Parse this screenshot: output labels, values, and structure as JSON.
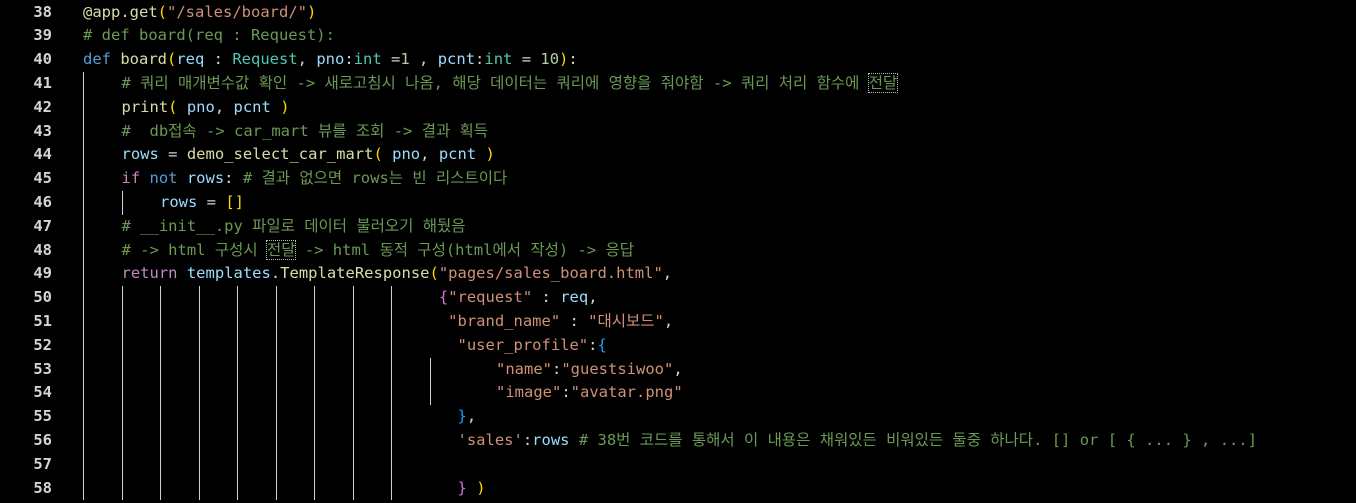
{
  "editor": {
    "lines": [
      {
        "n": "38",
        "ind": 0,
        "tokens": [
          [
            "fn",
            "@app.get"
          ],
          [
            "br1",
            "("
          ],
          [
            "str",
            "\"/sales/board/\""
          ],
          [
            "br1",
            ")"
          ]
        ]
      },
      {
        "n": "39",
        "ind": 0,
        "tokens": [
          [
            "cm",
            "# def board(req : Request):"
          ]
        ]
      },
      {
        "n": "40",
        "ind": 0,
        "tokens": [
          [
            "kw",
            "def "
          ],
          [
            "fn",
            "board"
          ],
          [
            "br1",
            "("
          ],
          [
            "var",
            "req"
          ],
          [
            "txt",
            " : "
          ],
          [
            "cls",
            "Request"
          ],
          [
            "txt",
            ", "
          ],
          [
            "var",
            "pno"
          ],
          [
            "txt",
            ":"
          ],
          [
            "cls",
            "int"
          ],
          [
            "txt",
            " ="
          ],
          [
            "num",
            "1"
          ],
          [
            "txt",
            " , "
          ],
          [
            "var",
            "pcnt"
          ],
          [
            "txt",
            ":"
          ],
          [
            "cls",
            "int"
          ],
          [
            "txt",
            " = "
          ],
          [
            "num",
            "10"
          ],
          [
            "br1",
            ")"
          ],
          [
            "txt",
            ":"
          ]
        ]
      },
      {
        "n": "41",
        "ind": 1,
        "tokens": [
          [
            "cm",
            "# 쿼리 매개변수값 확인 -> 새로고침시 나옴, 해당 데이터는 쿼리에 영향을 줘야함 -> 쿼리 처리 함수에 "
          ],
          [
            "cmbox",
            "전달"
          ]
        ]
      },
      {
        "n": "42",
        "ind": 1,
        "tokens": [
          [
            "fn",
            "print"
          ],
          [
            "br1",
            "("
          ],
          [
            "var",
            " pno"
          ],
          [
            "txt",
            ", "
          ],
          [
            "var",
            "pcnt "
          ],
          [
            "br1",
            ")"
          ]
        ]
      },
      {
        "n": "43",
        "ind": 1,
        "tokens": [
          [
            "cm",
            "#  db접속 -> car_mart 뷰를 조회 -> 결과 획득"
          ]
        ]
      },
      {
        "n": "44",
        "ind": 1,
        "tokens": [
          [
            "var",
            "rows"
          ],
          [
            "txt",
            " = "
          ],
          [
            "fn",
            "demo_select_car_mart"
          ],
          [
            "br1",
            "("
          ],
          [
            "var",
            " pno"
          ],
          [
            "txt",
            ", "
          ],
          [
            "var",
            "pcnt "
          ],
          [
            "br1",
            ")"
          ]
        ]
      },
      {
        "n": "45",
        "ind": 1,
        "tokens": [
          [
            "ctl",
            "if "
          ],
          [
            "kw",
            "not "
          ],
          [
            "var",
            "rows"
          ],
          [
            "txt",
            ": "
          ],
          [
            "cm",
            "# 결과 없으면 rows는 빈 리스트이다"
          ]
        ]
      },
      {
        "n": "46",
        "ind": 2,
        "tokens": [
          [
            "var",
            "rows"
          ],
          [
            "txt",
            " = "
          ],
          [
            "br1",
            "[]"
          ]
        ]
      },
      {
        "n": "47",
        "ind": 1,
        "tokens": [
          [
            "cm",
            "# __init__.py 파일로 데이터 불러오기 해뒀음"
          ]
        ]
      },
      {
        "n": "48",
        "ind": 1,
        "tokens": [
          [
            "cm",
            "# -> html 구성시 "
          ],
          [
            "cmbox",
            "전달"
          ],
          [
            "cm",
            " -> html 동적 구성(html에서 작성) -> 응답"
          ]
        ]
      },
      {
        "n": "49",
        "ind": 1,
        "tokens": [
          [
            "ctl",
            "return "
          ],
          [
            "var",
            "templates"
          ],
          [
            "txt",
            "."
          ],
          [
            "fn",
            "TemplateResponse"
          ],
          [
            "br1",
            "("
          ],
          [
            "str",
            "\"pages/sales_board.html\""
          ],
          [
            "txt",
            ","
          ]
        ]
      },
      {
        "n": "50",
        "ind": 9,
        "tokens": [
          [
            "txt",
            " "
          ],
          [
            "br2",
            "{"
          ],
          [
            "str",
            "\"request\""
          ],
          [
            "txt",
            " : "
          ],
          [
            "var",
            "req"
          ],
          [
            "txt",
            ","
          ]
        ]
      },
      {
        "n": "51",
        "ind": 9,
        "tokens": [
          [
            "txt",
            "  "
          ],
          [
            "str",
            "\"brand_name\""
          ],
          [
            "txt",
            " : "
          ],
          [
            "str",
            "\"대시보드\""
          ],
          [
            "txt",
            ","
          ]
        ]
      },
      {
        "n": "52",
        "ind": 9,
        "tokens": [
          [
            "txt",
            "   "
          ],
          [
            "str",
            "\"user_profile\""
          ],
          [
            "txt",
            ":"
          ],
          [
            "br3",
            "{"
          ]
        ]
      },
      {
        "n": "53",
        "ind": 10,
        "tokens": [
          [
            "txt",
            "   "
          ],
          [
            "str",
            "\"name\""
          ],
          [
            "txt",
            ":"
          ],
          [
            "str",
            "\"guestsiwoo\""
          ],
          [
            "txt",
            ","
          ]
        ]
      },
      {
        "n": "54",
        "ind": 10,
        "tokens": [
          [
            "txt",
            "   "
          ],
          [
            "str",
            "\"image\""
          ],
          [
            "txt",
            ":"
          ],
          [
            "str",
            "\"avatar.png\""
          ]
        ]
      },
      {
        "n": "55",
        "ind": 9,
        "tokens": [
          [
            "txt",
            "   "
          ],
          [
            "br3",
            "}"
          ],
          [
            "txt",
            ","
          ]
        ]
      },
      {
        "n": "56",
        "ind": 9,
        "tokens": [
          [
            "txt",
            "   "
          ],
          [
            "str",
            "'sales'"
          ],
          [
            "txt",
            ":"
          ],
          [
            "var",
            "rows"
          ],
          [
            "txt",
            " "
          ],
          [
            "cm",
            "# 38번 코드를 통해서 이 내용은 채워있든 비워있든 둘중 하나다. [] or [ { ... } , ...]"
          ]
        ]
      },
      {
        "n": "57",
        "ind": 9,
        "tokens": []
      },
      {
        "n": "58",
        "ind": 9,
        "tokens": [
          [
            "txt",
            "   "
          ],
          [
            "br2",
            "}"
          ],
          [
            "txt",
            " "
          ],
          [
            "br1",
            ")"
          ]
        ]
      }
    ]
  }
}
